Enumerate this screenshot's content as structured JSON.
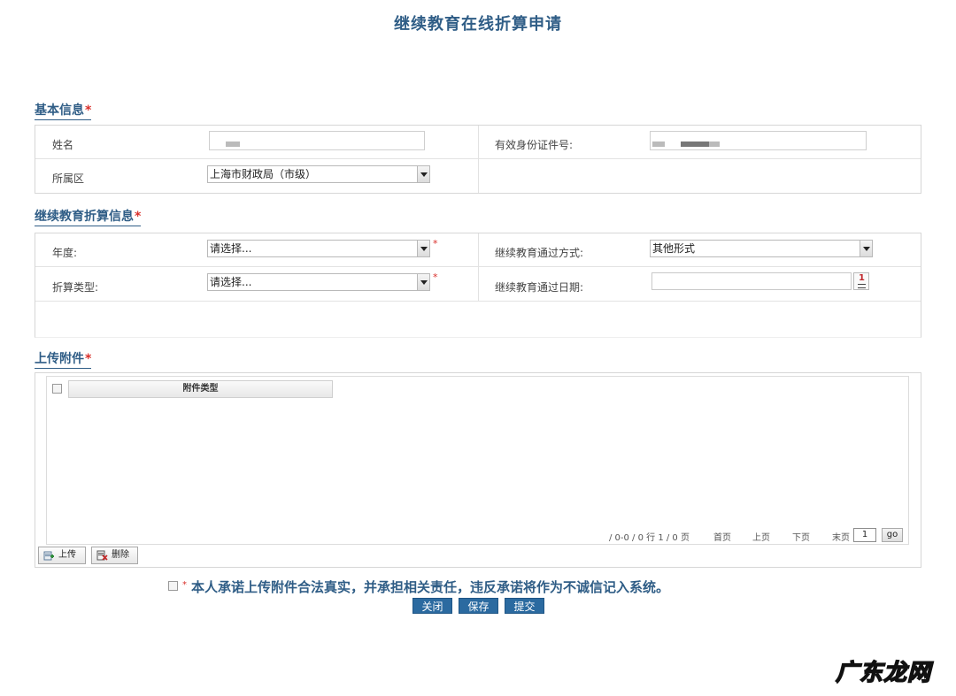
{
  "page": {
    "title": "继续教育在线折算申请"
  },
  "basic_info": {
    "section_title": "基本信息",
    "required_mark": "*",
    "name_label": "姓名",
    "id_label": "有效身份证件号:",
    "district_label": "所属区",
    "district_value": "上海市财政局（市级）"
  },
  "conversion_info": {
    "section_title": "继续教育折算信息",
    "required_mark": "*",
    "year_label": "年度:",
    "year_value": "请选择...",
    "year_required": "*",
    "method_label": "继续教育通过方式:",
    "method_value": "其他形式",
    "type_label": "折算类型:",
    "type_value": "请选择...",
    "type_required": "*",
    "date_label": "继续教育通过日期:",
    "date_value": ""
  },
  "attachments": {
    "section_title": "上传附件",
    "required_mark": "*",
    "column_header": "附件类型",
    "pager": {
      "summary": "/ 0-0 / 0 行 1 / 0 页",
      "first": "首页",
      "prev": "上页",
      "next": "下页",
      "last": "末页",
      "page_value": "1",
      "go": "go"
    },
    "upload_button": "上传",
    "delete_button": "删除"
  },
  "promise": {
    "required_mark": "*",
    "text": "本人承诺上传附件合法真实，并承担相关责任，违反承诺将作为不诚信记入系统。"
  },
  "actions": {
    "close": "关闭",
    "save": "保存",
    "submit": "提交"
  },
  "watermark": "广东龙网",
  "colors": {
    "title": "#2f5d86",
    "required": "#d9302b",
    "button": "#2b6aa0"
  }
}
